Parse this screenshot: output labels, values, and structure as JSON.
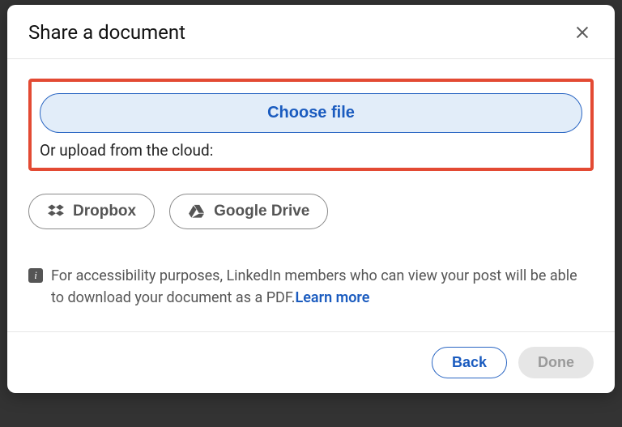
{
  "header": {
    "title": "Share a document"
  },
  "upload": {
    "choose_file_label": "Choose file",
    "cloud_prompt": "Or upload from the cloud:"
  },
  "cloud": {
    "dropbox_label": "Dropbox",
    "gdrive_label": "Google Drive"
  },
  "info": {
    "text": "For accessibility purposes, LinkedIn members who can view your post will be able to download your document as a PDF.",
    "learn_more": "Learn more"
  },
  "footer": {
    "back_label": "Back",
    "done_label": "Done"
  }
}
